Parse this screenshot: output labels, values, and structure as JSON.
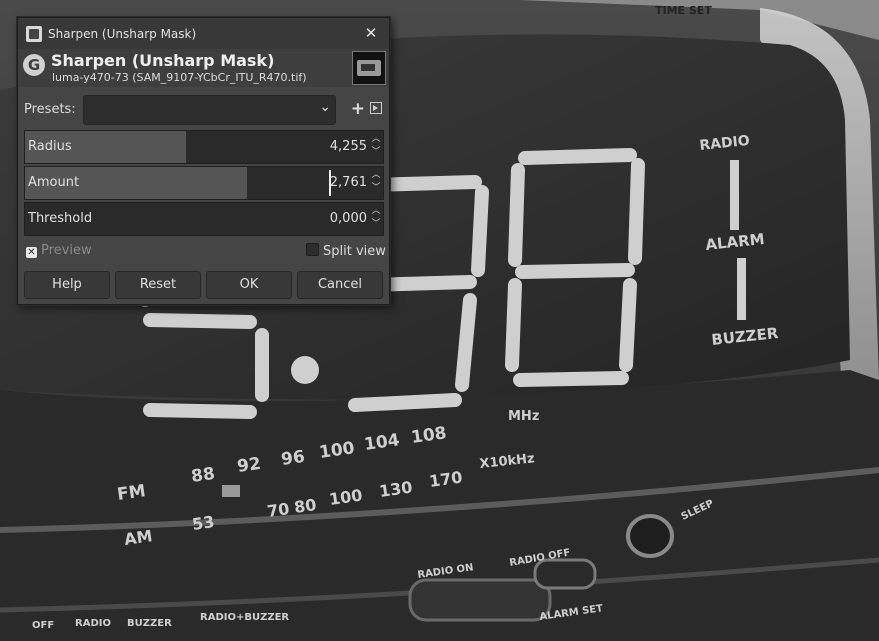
{
  "window": {
    "title": "Sharpen (Unsharp Mask)",
    "close_icon": "close-icon"
  },
  "header": {
    "title": "Sharpen (Unsharp Mask)",
    "subtitle": "luma-y470-73 (SAM_9107-YCbCr_ITU_R470.tif)",
    "logo": "G"
  },
  "presets": {
    "label": "Presets:",
    "value": "",
    "add_icon": "plus-icon",
    "menu_icon": "menu-icon"
  },
  "params": [
    {
      "label": "Radius",
      "value": "4,255",
      "fill": 0.45
    },
    {
      "label": "Amount",
      "value": "2,761",
      "fill": 0.62
    },
    {
      "label": "Threshold",
      "value": "0,000",
      "fill": 0.0
    }
  ],
  "preview": {
    "label": "Preview",
    "checked": true
  },
  "split_view": {
    "label": "Split view",
    "checked": false
  },
  "buttons": {
    "help": "Help",
    "reset": "Reset",
    "ok": "OK",
    "cancel": "Cancel"
  },
  "background_image": {
    "display": "5:98",
    "labels": {
      "radio": "RADIO",
      "alarm": "ALARM",
      "buzzer": "BUZZER",
      "mhz": "MHz",
      "khz": "X10kHz",
      "fm": "FM",
      "am": "AM",
      "radio_on": "RADIO ON",
      "radio_off": "RADIO OFF",
      "alarm_set": "ALARM SET",
      "sleep": "SLEEP",
      "time_set": "TIME SET",
      "off": "OFF",
      "radio_btn": "RADIO",
      "buzzer_btn": "BUZZER",
      "radio_buzzer": "RADIO+BUZZER"
    },
    "fm_scale": [
      "88",
      "92",
      "96",
      "100",
      "104",
      "108"
    ],
    "am_scale": [
      "53",
      "70",
      "80",
      "100",
      "130",
      "170"
    ]
  }
}
